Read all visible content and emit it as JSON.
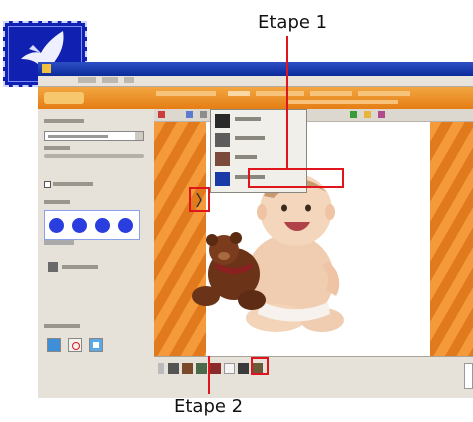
{
  "annotations": {
    "step1_label": "Etape 1",
    "step2_label": "Etape 2",
    "color": "#e0141c"
  },
  "stamp": {
    "icon": "bird-icon",
    "color": "#1020b0"
  },
  "tools_menu": {
    "items": [
      {
        "icon": "stamp-tool-icon"
      },
      {
        "icon": "tool-icon"
      },
      {
        "icon": "photo-tool-icon"
      },
      {
        "icon": "magic-wand-icon",
        "highlighted": true
      }
    ]
  },
  "colors": {
    "canvas_border": "#f08a26",
    "title_bar": "#0a2a9a",
    "brush": "#2a3ee0"
  }
}
